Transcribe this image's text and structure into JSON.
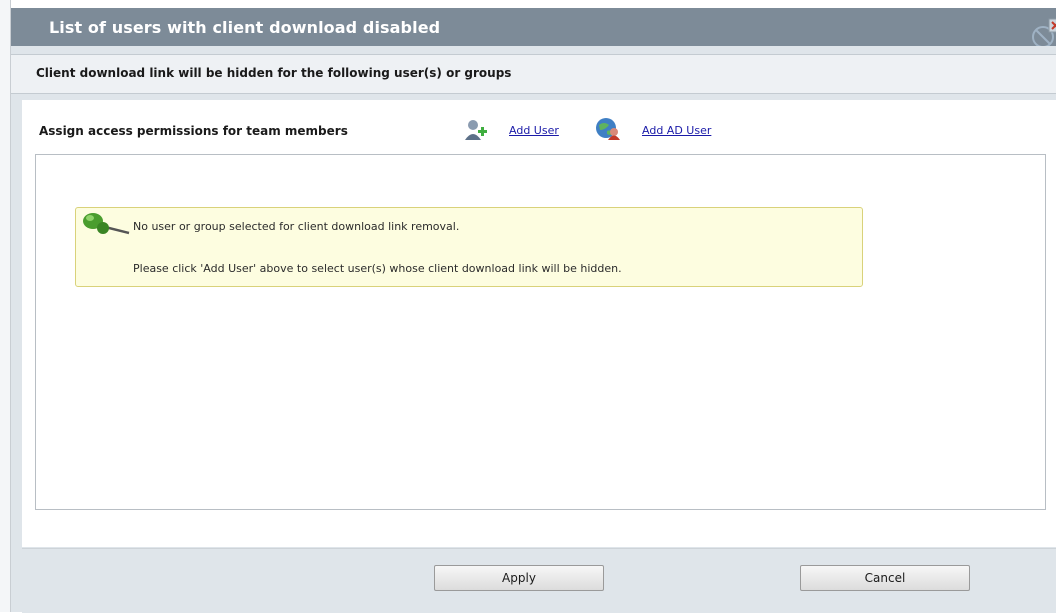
{
  "dialog": {
    "title": "List of users with client download disabled",
    "subheader": "Client download link will be hidden for the following user(s) or groups"
  },
  "assign": {
    "label": "Assign access permissions for team members",
    "add_user_icon": "user-add-icon",
    "add_user_label": "Add User",
    "add_ad_user_icon": "ad-user-globe-icon",
    "add_ad_user_label": "Add AD User"
  },
  "notice": {
    "icon": "pushpin-icon",
    "line1": "No user or group selected for client download link removal.",
    "line2": "Please click 'Add User' above to select user(s) whose client download link will be hidden."
  },
  "buttons": {
    "apply": "Apply",
    "cancel": "Cancel"
  },
  "colors": {
    "titlebar": "#7d8b98",
    "notice_bg": "#fdfde0",
    "link": "#1a1aa8"
  }
}
